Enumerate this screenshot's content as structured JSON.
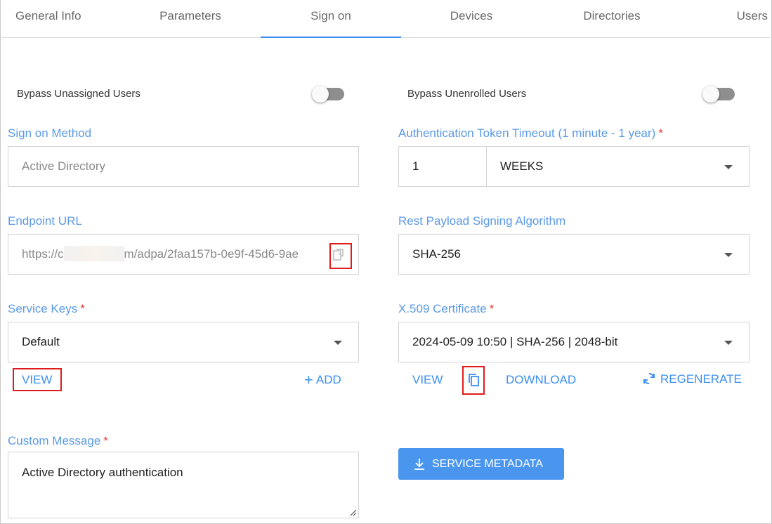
{
  "tabs": [
    {
      "label": "General Info"
    },
    {
      "label": "Parameters"
    },
    {
      "label": "Sign on"
    },
    {
      "label": "Devices"
    },
    {
      "label": "Directories"
    },
    {
      "label": "Users"
    }
  ],
  "active_tab": "Sign on",
  "bypass_unassigned": {
    "label": "Bypass Unassigned Users",
    "enabled": false
  },
  "bypass_unenrolled": {
    "label": "Bypass Unenrolled Users",
    "enabled": false
  },
  "sign_on_method": {
    "label": "Sign on Method",
    "value": "Active Directory"
  },
  "token_timeout": {
    "label": "Authentication Token Timeout (1 minute - 1 year)",
    "required": "*",
    "amount": "1",
    "unit": "WEEKS"
  },
  "endpoint_url": {
    "label": "Endpoint URL",
    "value_start": "https://c",
    "value_end": "m/adpa/2faa157b-0e9f-45d6-9ae"
  },
  "rest_payload": {
    "label": "Rest Payload Signing Algorithm",
    "value": "SHA-256"
  },
  "service_keys": {
    "label": "Service Keys",
    "required": "*",
    "value": "Default",
    "view": "VIEW",
    "add": "ADD",
    "add_icon": "+"
  },
  "certificate": {
    "label": "X.509 Certificate",
    "required": "*",
    "value": "2024-05-09 10:50 | SHA-256 | 2048-bit",
    "view": "VIEW",
    "download": "DOWNLOAD",
    "regenerate": "REGENERATE"
  },
  "custom_message": {
    "label": "Custom Message",
    "required": "*",
    "value": "Active Directory authentication"
  },
  "service_metadata": {
    "label": "SERVICE METADATA"
  },
  "colors": {
    "accent": "#3b8ff0",
    "label": "#5b9ae6",
    "required": "#e23b3b",
    "highlight": "#e01b1b",
    "button": "#4a96ee"
  }
}
